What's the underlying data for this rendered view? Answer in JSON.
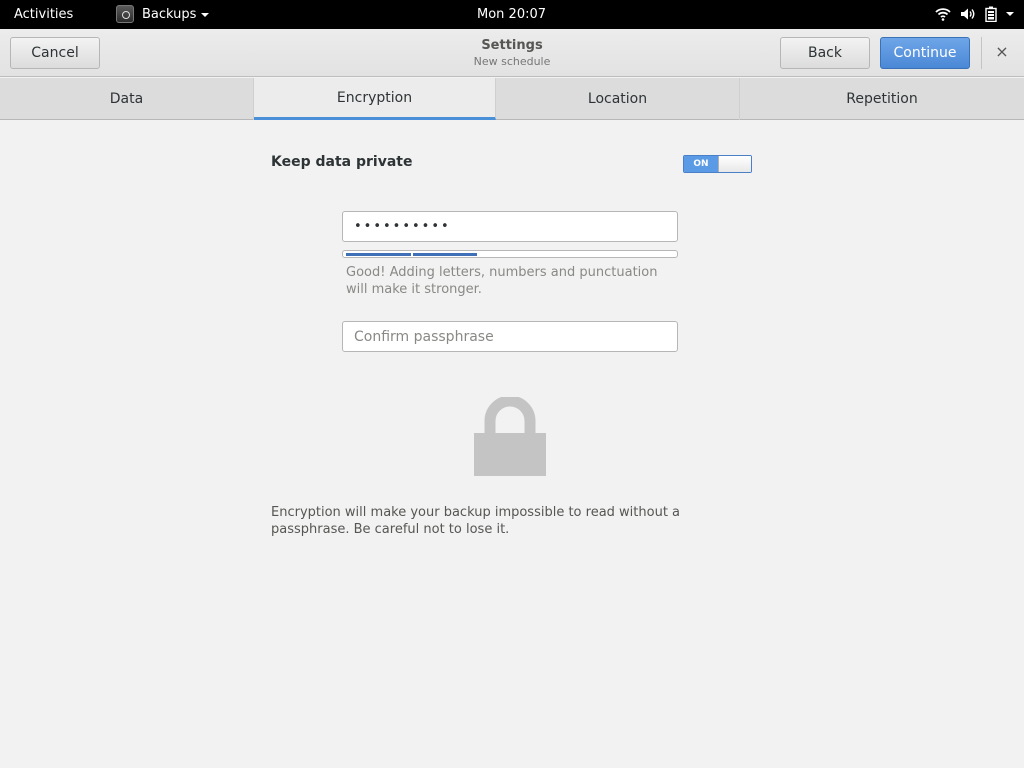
{
  "topbar": {
    "activities": "Activities",
    "app_name": "Backups",
    "clock": "Mon 20:07",
    "icons": [
      "wifi-icon",
      "volume-icon",
      "battery-icon",
      "chevron-down-icon"
    ]
  },
  "headerbar": {
    "title": "Settings",
    "subtitle": "New schedule",
    "cancel_label": "Cancel",
    "back_label": "Back",
    "continue_label": "Continue",
    "close_glyph": "×",
    "accent_color": "#4a88d6"
  },
  "tabs": [
    {
      "label": "Data",
      "active": false
    },
    {
      "label": "Encryption",
      "active": true
    },
    {
      "label": "Location",
      "active": false
    },
    {
      "label": "Repetition",
      "active": false
    }
  ],
  "encryption": {
    "keep_private_label": "Keep data private",
    "switch_text": "ON",
    "switch_state": true,
    "passphrase_masked": "••••••••••",
    "strength_fraction": 0.4,
    "strength_hint": "Good! Adding letters, numbers and punctuation will make it stronger.",
    "confirm_placeholder": "Confirm passphrase",
    "lock_icon": "lock-icon",
    "explanation": "Encryption will make your backup impossible to read without a passphrase. Be careful not to lose it."
  }
}
